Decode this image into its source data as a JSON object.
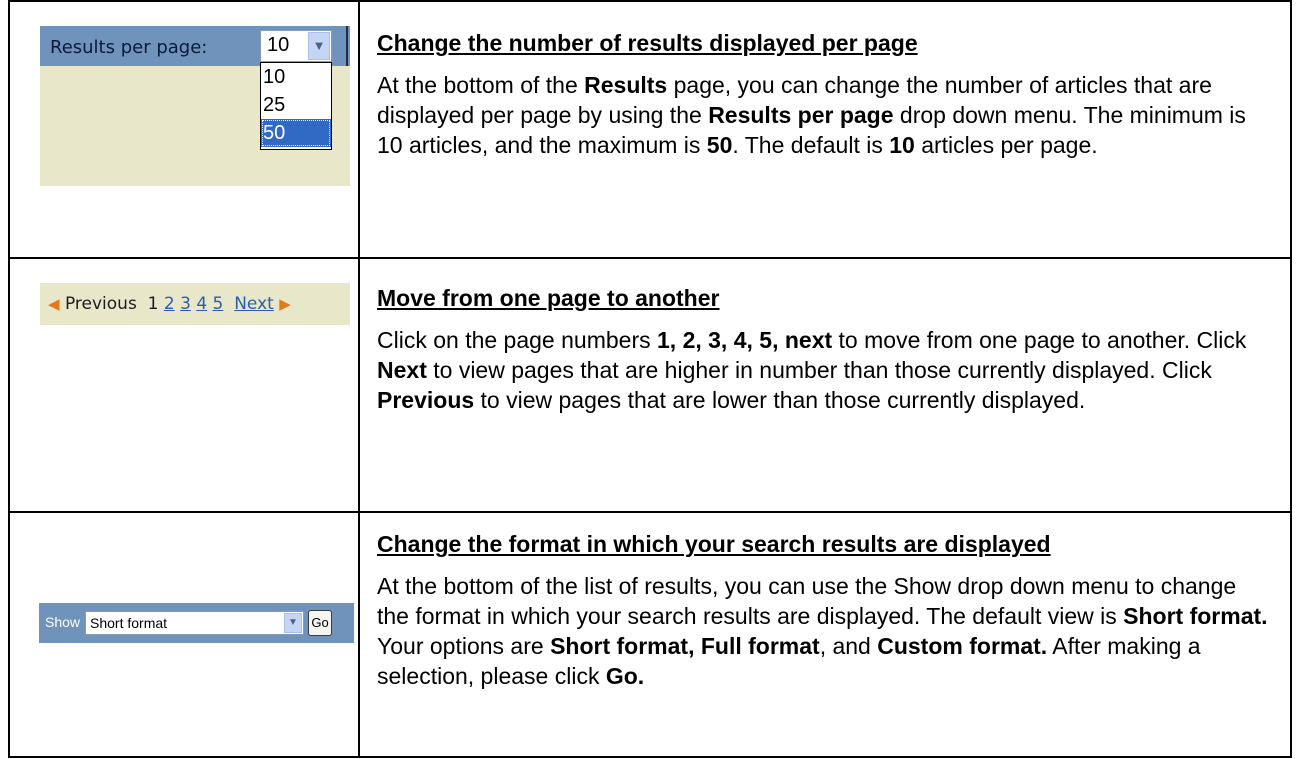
{
  "rows": [
    {
      "widget": {
        "label": "Results per page:",
        "selected": "10",
        "options": [
          "10",
          "25",
          "50"
        ],
        "highlighted": "50",
        "dropdown_icon": "chevron-down-icon"
      },
      "heading": "Change the number of results displayed per page",
      "p": [
        "At the bottom of the ",
        "Results",
        " page, you can change the number of articles that are displayed per page by using the ",
        "Results per page",
        " drop down menu.   The minimum is 10 articles, and the maximum is ",
        "50",
        ". The default is ",
        "10",
        " articles per page."
      ]
    },
    {
      "widget": {
        "prev_label": "Previous",
        "current_page": "1",
        "pages": [
          "2",
          "3",
          "4",
          "5"
        ],
        "next_label": "Next",
        "prev_icon": "triangle-left-icon",
        "next_icon": "triangle-right-icon"
      },
      "heading": "Move from one page to another",
      "p": [
        "Click on the page numbers ",
        "1, 2, 3, 4, 5, next",
        " to move from one page to another.  Click ",
        "Next",
        " to view pages that are higher in number than those currently displayed.  Click ",
        "Previous",
        " to view pages that are lower than those currently displayed."
      ]
    },
    {
      "widget": {
        "label": "Show",
        "selected": "Short format",
        "go_label": "Go",
        "dropdown_icon": "chevron-down-icon"
      },
      "heading": "Change the format in which your search results are displayed",
      "p": [
        "At the bottom of the list of results, you can use the Show drop down menu to change the format in which your search results are displayed. The default view is ",
        "Short format.",
        "  Your options are ",
        "Short format, Full format",
        ", and ",
        "Custom format.",
        "  After making a selection, please click ",
        "Go."
      ]
    }
  ],
  "colors": {
    "widget_bar": "#6f93ba",
    "widget_bg": "#e8e7c9",
    "link": "#2a5db0",
    "arrow": "#e07b1c",
    "selected_option": "#316ac5"
  }
}
